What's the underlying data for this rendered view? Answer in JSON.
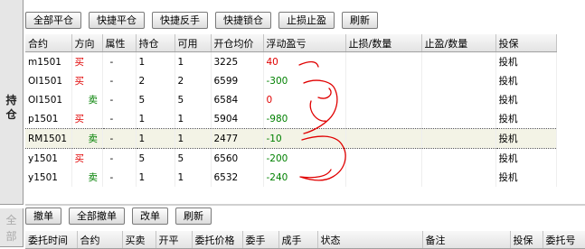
{
  "side_tabs": {
    "positions": [
      "持",
      "仓"
    ],
    "orders": [
      "全",
      "部"
    ]
  },
  "position_toolbar": [
    "全部平仓",
    "快捷平仓",
    "快捷反手",
    "快捷锁仓",
    "止损止盈",
    "刷新"
  ],
  "positions_table": {
    "columns": [
      "合约",
      "方向",
      "属性",
      "持仓",
      "可用",
      "开仓均价",
      "浮动盈亏",
      "止损/数量",
      "止盈/数量",
      "投保"
    ],
    "rows": [
      {
        "contract": "m1501",
        "direction": "买",
        "dir_color": "red",
        "attr": "-",
        "qty": "1",
        "avail": "1",
        "avg_price": "3225",
        "pnl": "40",
        "pnl_color": "red",
        "sl": "",
        "tp": "",
        "hedge": "投机"
      },
      {
        "contract": "OI1501",
        "direction": "买",
        "dir_color": "red",
        "attr": "-",
        "qty": "2",
        "avail": "2",
        "avg_price": "6599",
        "pnl": "-300",
        "pnl_color": "green",
        "sl": "",
        "tp": "",
        "hedge": "投机"
      },
      {
        "contract": "OI1501",
        "direction": "卖",
        "dir_color": "green",
        "attr": "-",
        "qty": "5",
        "avail": "5",
        "avg_price": "6584",
        "pnl": "0",
        "pnl_color": "red",
        "sl": "",
        "tp": "",
        "hedge": "投机"
      },
      {
        "contract": "p1501",
        "direction": "买",
        "dir_color": "red",
        "attr": "-",
        "qty": "1",
        "avail": "1",
        "avg_price": "5904",
        "pnl": "-980",
        "pnl_color": "green",
        "sl": "",
        "tp": "",
        "hedge": "投机"
      },
      {
        "contract": "RM1501",
        "direction": "卖",
        "dir_color": "green",
        "attr": "-",
        "qty": "1",
        "avail": "1",
        "avg_price": "2477",
        "pnl": "-10",
        "pnl_color": "green",
        "sl": "",
        "tp": "",
        "hedge": "投机",
        "selected": true
      },
      {
        "contract": "y1501",
        "direction": "买",
        "dir_color": "red",
        "attr": "-",
        "qty": "5",
        "avail": "5",
        "avg_price": "6560",
        "pnl": "-200",
        "pnl_color": "green",
        "sl": "",
        "tp": "",
        "hedge": "投机"
      },
      {
        "contract": "y1501",
        "direction": "卖",
        "dir_color": "green",
        "attr": "-",
        "qty": "1",
        "avail": "1",
        "avg_price": "6532",
        "pnl": "-240",
        "pnl_color": "green",
        "sl": "",
        "tp": "",
        "hedge": "投机"
      }
    ]
  },
  "order_toolbar": [
    "撤单",
    "全部撤单",
    "改单",
    "刷新"
  ],
  "orders_table": {
    "columns": [
      "委托时间",
      "合约",
      "买卖",
      "开平",
      "委托价格",
      "委手",
      "成手",
      "状态",
      "备注",
      "投保",
      "委托号"
    ]
  },
  "colors": {
    "red": "#e00000",
    "green": "#008000",
    "annotation": "#e00000"
  }
}
